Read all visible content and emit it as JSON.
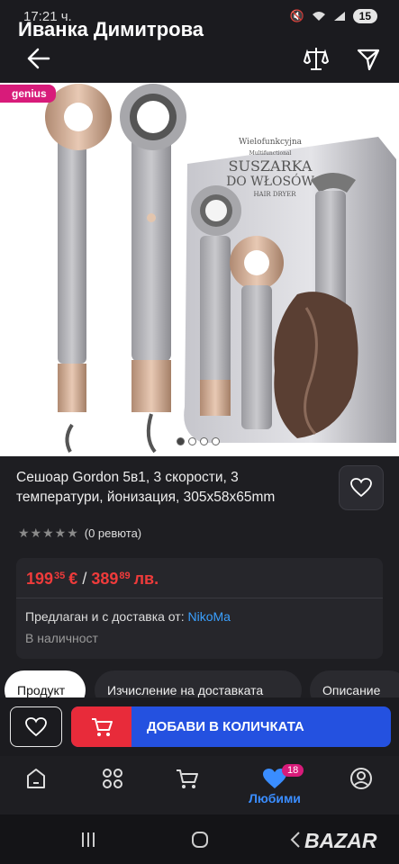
{
  "status_bar": {
    "time": "17:21 ч.",
    "battery": "15"
  },
  "top_bar": {
    "seller_name": "Иванка Димитрова"
  },
  "product_image": {
    "badge": "genius",
    "image_count": 4,
    "active_index": 0,
    "packaging": {
      "line1": "Wielofunkcyjna",
      "line2": "Multifunctional",
      "line3": "SUSZARKA",
      "line4": "DO WŁOSÓW",
      "line5": "HAIR DRYER"
    }
  },
  "product": {
    "title": "Сешоар Gordon 5в1, 3 скорости, 3 температури, йонизация, 305x58x65mm",
    "rating_text": "(0 ревюта)",
    "price_eur_main": "199",
    "price_eur_cents": "35",
    "price_eur_currency": "€",
    "price_slash": "/",
    "price_bgn_main": "389",
    "price_bgn_cents": "89",
    "price_bgn_currency": "лв.",
    "offered_label": "Предлаган и с доставка от:",
    "seller_link": "NikoMa",
    "stock": "В наличност"
  },
  "tabs": [
    {
      "label": "Продукт",
      "active": true
    },
    {
      "label": "Изчисление на доставката",
      "active": false
    },
    {
      "label": "Описание",
      "active": false
    }
  ],
  "action_bar": {
    "add_label": "ДОБАВИ В КОЛИЧКАТА"
  },
  "bottom_nav": {
    "favorites_label": "Любими",
    "favorites_count": "18"
  },
  "watermark": "BAZAR",
  "colors": {
    "accent": "#2451e0",
    "cart": "#e82b3a",
    "price": "#ef3b3b",
    "link": "#3aa0ff",
    "genius": "#d81b7a"
  }
}
